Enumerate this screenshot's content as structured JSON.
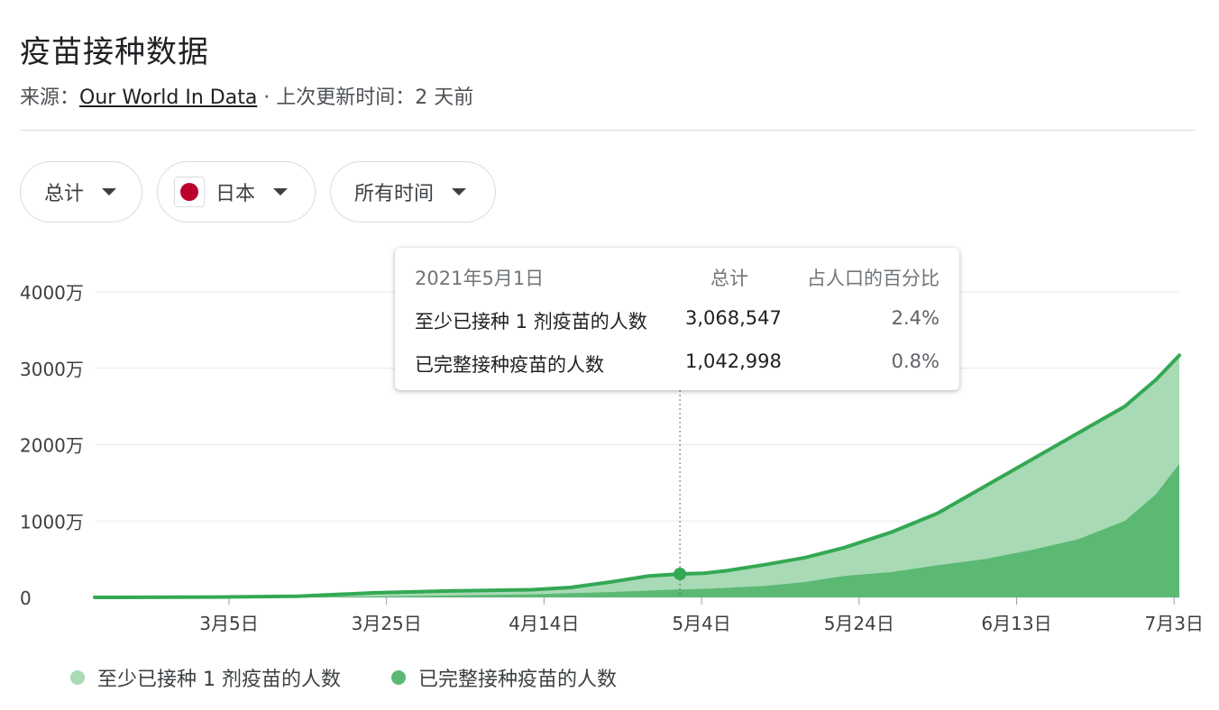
{
  "header": {
    "title": "疫苗接种数据",
    "source_prefix": "来源：",
    "source_link": "Our World In Data",
    "updated": " · 上次更新时间：2 天前"
  },
  "filters": {
    "metric": "总计",
    "country": "日本",
    "range": "所有时间"
  },
  "tooltip": {
    "date": "2021年5月1日",
    "col_total": "总计",
    "col_pct": "占人口的百分比",
    "rows": [
      {
        "label": "至少已接种 1 剂疫苗的人数",
        "total": "3,068,547",
        "pct": "2.4%"
      },
      {
        "label": "已完整接种疫苗的人数",
        "total": "1,042,998",
        "pct": "0.8%"
      }
    ]
  },
  "legend": [
    {
      "label": "至少已接种 1 剂疫苗的人数",
      "color": "#a8dab5"
    },
    {
      "label": "已完整接种疫苗的人数",
      "color": "#5bb974"
    }
  ],
  "colors": {
    "at_least_one_fill": "#a8dab5",
    "fully_fill": "#5bb974",
    "line": "#34a853",
    "grid": "#e8eaed"
  },
  "chart_data": {
    "type": "area",
    "x_ticks": [
      "3月5日",
      "3月25日",
      "4月14日",
      "5月4日",
      "5月24日",
      "6月13日",
      "7月3日"
    ],
    "y_ticks": [
      "0",
      "1000万",
      "2000万",
      "3000万",
      "4000万"
    ],
    "ylim": [
      0,
      40000000
    ],
    "x_range_days": [
      -16,
      123
    ],
    "series": [
      {
        "name": "至少已接种 1 剂疫苗的人数",
        "points": [
          [
            -16,
            0
          ],
          [
            0,
            40000
          ],
          [
            10,
            150000
          ],
          [
            20,
            600000
          ],
          [
            30,
            850000
          ],
          [
            40,
            1000000
          ],
          [
            45,
            1300000
          ],
          [
            50,
            2000000
          ],
          [
            55,
            2800000
          ],
          [
            59,
            3068547
          ],
          [
            62,
            3150000
          ],
          [
            65,
            3500000
          ],
          [
            70,
            4300000
          ],
          [
            75,
            5200000
          ],
          [
            80,
            6500000
          ],
          [
            86,
            8500000
          ],
          [
            92,
            11000000
          ],
          [
            98,
            14500000
          ],
          [
            104,
            18000000
          ],
          [
            110,
            21500000
          ],
          [
            116,
            25000000
          ],
          [
            120,
            28500000
          ],
          [
            123,
            31700000
          ]
        ]
      },
      {
        "name": "已完整接种疫苗的人数",
        "points": [
          [
            -16,
            0
          ],
          [
            10,
            30000
          ],
          [
            20,
            120000
          ],
          [
            30,
            250000
          ],
          [
            40,
            400000
          ],
          [
            50,
            700000
          ],
          [
            59,
            1042998
          ],
          [
            62,
            1100000
          ],
          [
            70,
            1500000
          ],
          [
            75,
            2000000
          ],
          [
            80,
            2800000
          ],
          [
            86,
            3300000
          ],
          [
            92,
            4200000
          ],
          [
            98,
            5000000
          ],
          [
            104,
            6200000
          ],
          [
            110,
            7600000
          ],
          [
            116,
            10000000
          ],
          [
            120,
            13500000
          ],
          [
            123,
            17500000
          ]
        ]
      }
    ],
    "highlight": {
      "x": 59,
      "y": 3068547
    }
  }
}
